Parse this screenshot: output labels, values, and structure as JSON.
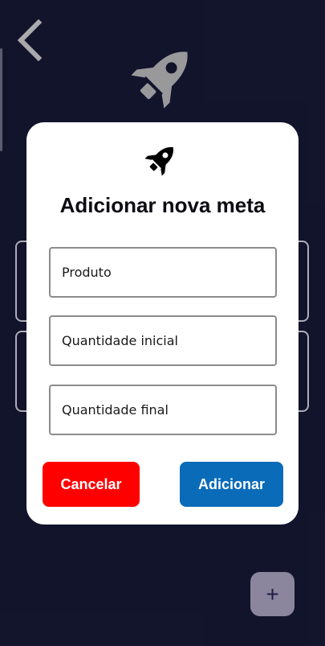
{
  "app": {
    "back_icon": "chevron-left-icon",
    "hero_icon": "rocket-icon"
  },
  "dialog": {
    "icon": "rocket-icon",
    "title": "Adicionar nova meta",
    "fields": {
      "product_placeholder": "Produto",
      "initial_qty_placeholder": "Quantidade inicial",
      "final_qty_placeholder": "Quantidade final"
    },
    "cancel_label": "Cancelar",
    "add_label": "Adicionar"
  },
  "fab": {
    "label": "+",
    "icon": "plus-icon"
  },
  "colors": {
    "background": "#14172f",
    "cancel": "#ff0000",
    "add": "#0a6bb9",
    "fab": "#a39cb6",
    "rocket_muted": "#b3b3b3"
  }
}
